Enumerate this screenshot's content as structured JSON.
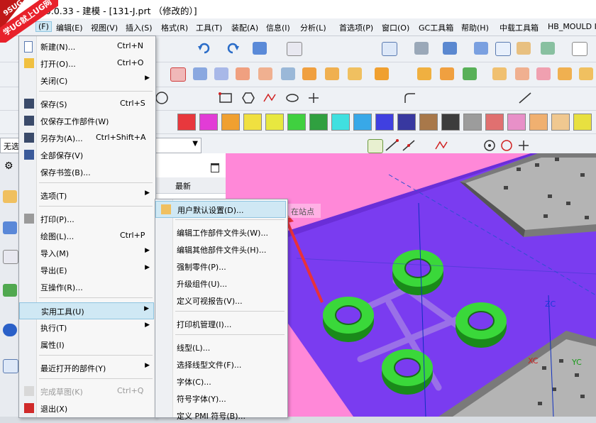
{
  "window": {
    "title": "1.0.0.33 - 建模 - [131-J.prt （修改的）]",
    "logo_top": "9SUG",
    "logo_text": "学UG就上UG网"
  },
  "menubar": {
    "file_short": "(F)",
    "items": [
      "编辑(E)",
      "视图(V)",
      "插入(S)",
      "格式(R)",
      "工具(T)",
      "装配(A)",
      "信息(I)",
      "分析(L)",
      "首选项(P)",
      "窗口(O)",
      "GC工具箱",
      "帮助(H)",
      "中载工具箱",
      "HB_MOULD I"
    ]
  },
  "combo": {
    "value": "无选"
  },
  "navigator": {
    "header": "最新"
  },
  "tooltip": {
    "text": "在站点"
  },
  "file_menu": {
    "items": [
      {
        "label": "新建(N)...",
        "shortcut": "Ctrl+N"
      },
      {
        "label": "打开(O)...",
        "shortcut": "Ctrl+O"
      },
      {
        "label": "关闭(C)",
        "submenu": true
      },
      {
        "label": "保存(S)",
        "shortcut": "Ctrl+S"
      },
      {
        "label": "仅保存工作部件(W)"
      },
      {
        "label": "另存为(A)...",
        "shortcut": "Ctrl+Shift+A"
      },
      {
        "label": "全部保存(V)"
      },
      {
        "label": "保存书签(B)..."
      },
      {
        "label": "选项(T)",
        "submenu": true
      },
      {
        "label": "打印(P)..."
      },
      {
        "label": "绘图(L)...",
        "shortcut": "Ctrl+P"
      },
      {
        "label": "导入(M)",
        "submenu": true
      },
      {
        "label": "导出(E)",
        "submenu": true
      },
      {
        "label": "互操作(R)..."
      },
      {
        "label": "实用工具(U)",
        "submenu": true
      },
      {
        "label": "执行(T)",
        "submenu": true
      },
      {
        "label": "属性(I)"
      },
      {
        "label": "最近打开的部件(Y)",
        "submenu": true
      },
      {
        "label": "完成草图(K)",
        "shortcut": "Ctrl+Q",
        "disabled": true
      },
      {
        "label": "退出(X)"
      }
    ]
  },
  "utilities_menu": {
    "items": [
      {
        "label": "用户默认设置(D)..."
      },
      {
        "label": "编辑工作部件文件头(W)..."
      },
      {
        "label": "编辑其他部件文件头(H)..."
      },
      {
        "label": "强制零件(P)..."
      },
      {
        "label": "升级组件(U)..."
      },
      {
        "label": "定义可视报告(V)..."
      },
      {
        "label": "打印机管理(I)..."
      },
      {
        "label": "线型(L)..."
      },
      {
        "label": "选择线型文件(F)..."
      },
      {
        "label": "字体(C)..."
      },
      {
        "label": "符号字体(Y)..."
      },
      {
        "label": "定义 PMI 符号(B)..."
      }
    ]
  },
  "viewport_labels": {
    "zc": "ZC",
    "yc": "YC",
    "xc": "XC"
  },
  "colors": {
    "swatches": [
      "#e8383d",
      "#e23cd6",
      "#f0a030",
      "#f0e040",
      "#e8e840",
      "#40d040",
      "#30a040",
      "#40e0e0",
      "#38a8e8",
      "#4040e0",
      "#3838a0",
      "#a8784a",
      "#3c3c3c",
      "#9c9c9c",
      "#e07070",
      "#e890c8",
      "#f0b070",
      "#f0c890",
      "#e8e040"
    ]
  }
}
